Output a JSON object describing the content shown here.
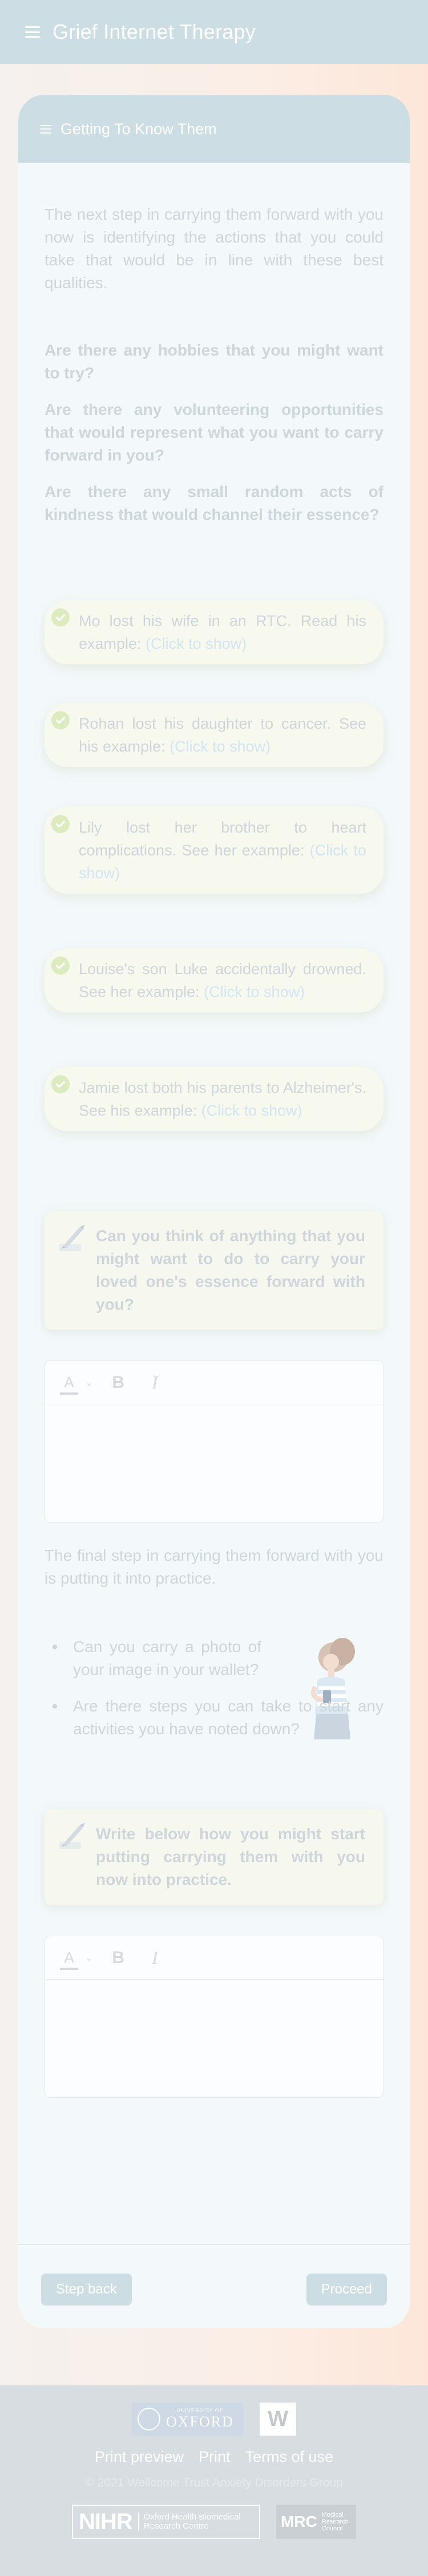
{
  "app": {
    "title": "Grief Internet Therapy"
  },
  "card": {
    "title": "Getting To Know Them"
  },
  "intro": "The next step in carrying them forward with you now is identifying the actions that you could take that would be in line with these best qualities.",
  "questions": [
    "Are there any hobbies that you might want to try?",
    "Are there any volunteering opportunities that would represent what you want to carry forward in you?",
    "Are there any small random acts of kindness that would channel their essence?"
  ],
  "examples": [
    {
      "text": "Mo lost his wife in an RTC. Read his example:",
      "link": "(Click to show)"
    },
    {
      "text": "Rohan lost his daughter to cancer. See his example:",
      "link": "(Click to show)"
    },
    {
      "text": "Lily lost her brother to heart complications. See her example:",
      "link": "(Click to show)"
    },
    {
      "text": "Louise's son Luke accidentally drowned. See her example:",
      "link": "(Click to show)"
    },
    {
      "text": "Jamie lost both his parents to Alzheimer's. See his example:",
      "link": "(Click to show)"
    }
  ],
  "prompt1": "Can you think of anything that you might want to do to carry your loved one's essence forward with you?",
  "editor": {
    "color_label": "A",
    "caret": "⌄",
    "bold": "B",
    "italic": "I"
  },
  "final_step": "The final step in carrying them forward with you is putting it into practice.",
  "bullets": [
    "Can you carry a photo of your image in your wallet?",
    "Are there steps you can take to start any activities you have noted down?"
  ],
  "prompt2": "Write below how you might start putting carrying them with you now into practice.",
  "nav": {
    "back": "Step back",
    "proceed": "Proceed"
  },
  "footer": {
    "oxford_small": "UNIVERSITY OF",
    "oxford_big": "OXFORD",
    "wellcome": "W",
    "links": [
      "Print preview",
      "Print",
      "Terms of use"
    ],
    "copyright": "© 2021 Wellcome Trust Anxiety Disorders Group",
    "nihr_big": "NIHR",
    "nihr_small_1": "Oxford Health Biomedical",
    "nihr_small_2": "Research Centre",
    "mrc_big": "MRC",
    "mrc_small_1": "Medical",
    "mrc_small_2": "Research",
    "mrc_small_3": "Council"
  },
  "colors": {
    "accent": "#ccdde4",
    "card_bg": "#f3f8fa",
    "muted_text": "#ced6db",
    "link": "#d3e4f3",
    "check": "#ddebc0"
  }
}
